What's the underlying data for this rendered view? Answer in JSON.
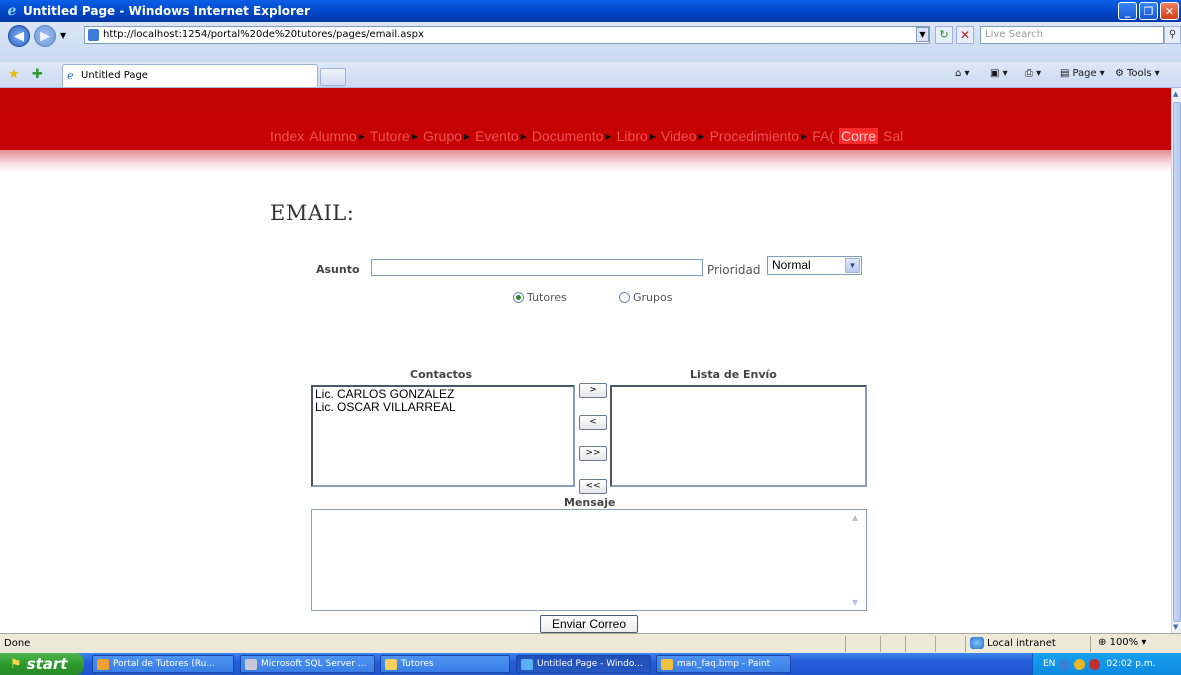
{
  "window": {
    "title": "Untitled Page - Windows Internet Explorer",
    "btn_min": "_",
    "btn_max": "❐",
    "btn_close": "✕"
  },
  "addressbar": {
    "url": "http://localhost:1254/portal%20de%20tutores/pages/email.aspx",
    "search_placeholder": "Live Search"
  },
  "tabs": {
    "active_label": "Untitled Page",
    "commands": {
      "page": "Page",
      "tools": "Tools"
    }
  },
  "site": {
    "menu": [
      {
        "label": "Index",
        "arrow": false
      },
      {
        "label": "Alumno",
        "arrow": true
      },
      {
        "label": "Tutore",
        "arrow": true
      },
      {
        "label": "Grupo",
        "arrow": true
      },
      {
        "label": "Evento",
        "arrow": true
      },
      {
        "label": "Documento",
        "arrow": true
      },
      {
        "label": "Libro",
        "arrow": true
      },
      {
        "label": "Video",
        "arrow": true
      },
      {
        "label": "Procedimiento",
        "arrow": true
      },
      {
        "label": "FA(",
        "arrow": false
      },
      {
        "label": "Corre",
        "arrow": false,
        "active": true
      },
      {
        "label": "Sal",
        "arrow": false
      }
    ],
    "colors": {
      "banner": "#c40404",
      "menu_text": "#ee5252",
      "active_menu_bg": "#ff2a2a"
    }
  },
  "form": {
    "page_title": "EMAIL:",
    "asunto_label": "Asunto",
    "asunto_value": "",
    "prioridad_label": "Prioridad",
    "prioridad_value": "Normal",
    "radio_tutores": "Tutores",
    "radio_grupos": "Grupos",
    "radio_selected": "Tutores",
    "contactos_header": "Contactos",
    "lista_header": "Lista de Envío",
    "contactos": [
      "Lic. CARLOS GONZALEZ",
      "Lic. OSCAR VILLARREAL"
    ],
    "lista_envio": [],
    "btn_add": ">",
    "btn_remove": "<",
    "btn_add_all": ">>",
    "btn_remove_all": "<<",
    "mensaje_label": "Mensaje",
    "mensaje_value": "",
    "send_button": "Enviar Correo"
  },
  "statusbar": {
    "status": "Done",
    "zone": "Local intranet",
    "zoom": "100%"
  },
  "taskbar": {
    "start": "start",
    "items": [
      {
        "label": "Portal de Tutores (Ru...",
        "icon": "folder-tools-icon",
        "active": false
      },
      {
        "label": "Microsoft SQL Server ...",
        "icon": "sql-server-icon",
        "active": false
      },
      {
        "label": "Tutores",
        "icon": "folder-icon",
        "active": false
      },
      {
        "label": "Untitled Page - Windo...",
        "icon": "ie-icon",
        "active": true
      },
      {
        "label": "man_faq.bmp - Paint",
        "icon": "paint-icon",
        "active": false
      }
    ],
    "language": "EN",
    "clock": "02:02 p.m."
  }
}
